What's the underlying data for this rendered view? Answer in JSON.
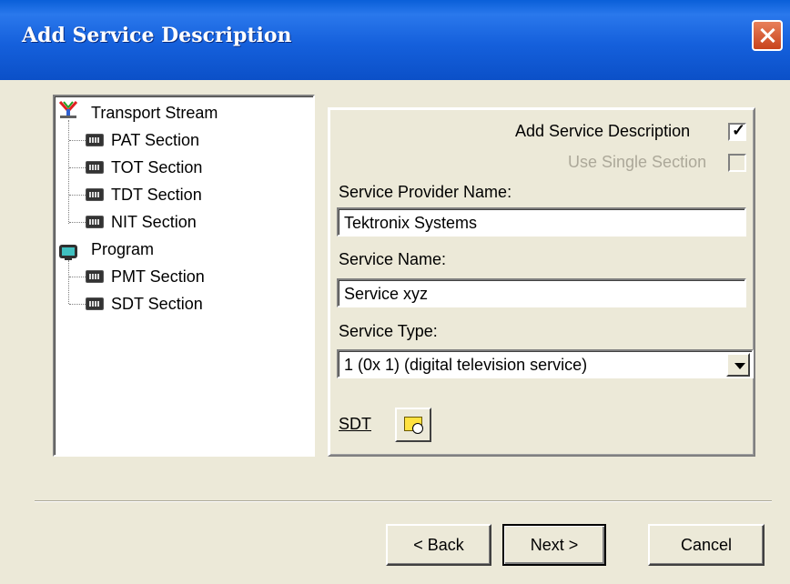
{
  "window": {
    "title": "Add Service Description"
  },
  "tree": {
    "items": [
      {
        "label": "Transport Stream",
        "icon": "transport-stream-icon"
      },
      {
        "label": "PAT Section",
        "icon": "section-icon"
      },
      {
        "label": "TOT Section",
        "icon": "section-icon"
      },
      {
        "label": "TDT Section",
        "icon": "section-icon"
      },
      {
        "label": "NIT Section",
        "icon": "section-icon"
      },
      {
        "label": "Program",
        "icon": "program-icon"
      },
      {
        "label": "PMT Section",
        "icon": "section-icon"
      },
      {
        "label": "SDT Section",
        "icon": "section-icon"
      }
    ]
  },
  "form": {
    "add_service_description": {
      "label": "Add Service Description",
      "checked": true
    },
    "use_single_section": {
      "label": "Use Single Section",
      "checked": false,
      "enabled": false
    },
    "service_provider_name": {
      "label": "Service Provider Name:",
      "value": "Tektronix Systems"
    },
    "service_name": {
      "label": "Service Name:",
      "value": "Service xyz"
    },
    "service_type": {
      "label": "Service Type:",
      "value": "1 (0x 1) (digital television service)"
    },
    "sdt": {
      "label": "SDT"
    }
  },
  "buttons": {
    "back": "< Back",
    "next": "Next >",
    "cancel": "Cancel"
  },
  "check_mark": "✓"
}
